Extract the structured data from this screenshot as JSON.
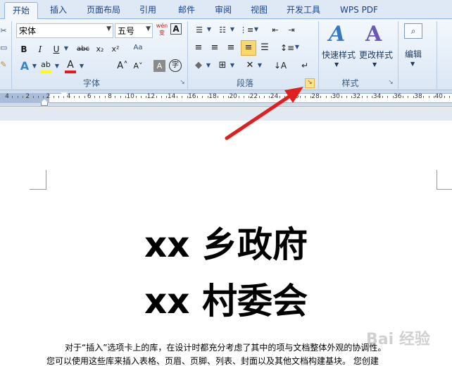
{
  "tabs": [
    "开始",
    "插入",
    "页面布局",
    "引用",
    "邮件",
    "审阅",
    "视图",
    "开发工具",
    "WPS PDF"
  ],
  "font": {
    "name": "宋体",
    "size": "五号",
    "wen_label": "wén 变"
  },
  "groups": {
    "font": "字体",
    "paragraph": "段落",
    "styles": "样式"
  },
  "styles": {
    "quick": "快速样式",
    "change": "更改样式"
  },
  "editing": {
    "label": "编辑"
  },
  "ruler": [
    "4",
    "2",
    "2",
    "4",
    "6",
    "8",
    "10",
    "12",
    "14",
    "16",
    "18",
    "20",
    "22",
    "24",
    "26",
    "28",
    "30",
    "32",
    "34",
    "36",
    "38",
    "40"
  ],
  "document": {
    "title1": "xx 乡政府",
    "title2": "xx 村委会",
    "line1": "对于“插入”选项卡上的库，在设计时都充分考虑了其中的项与文档整体外观的协调性。",
    "line2": "您可以使用这些库来插入表格、页眉、页脚、列表、封面以及其他文档构建基块。 您创建"
  },
  "watermark": "Bai 经验",
  "colors": {
    "accent": "#fbd86b",
    "highlight": "#ffff00",
    "font_red": "#e8191c",
    "arrow": "#e21f1f"
  }
}
